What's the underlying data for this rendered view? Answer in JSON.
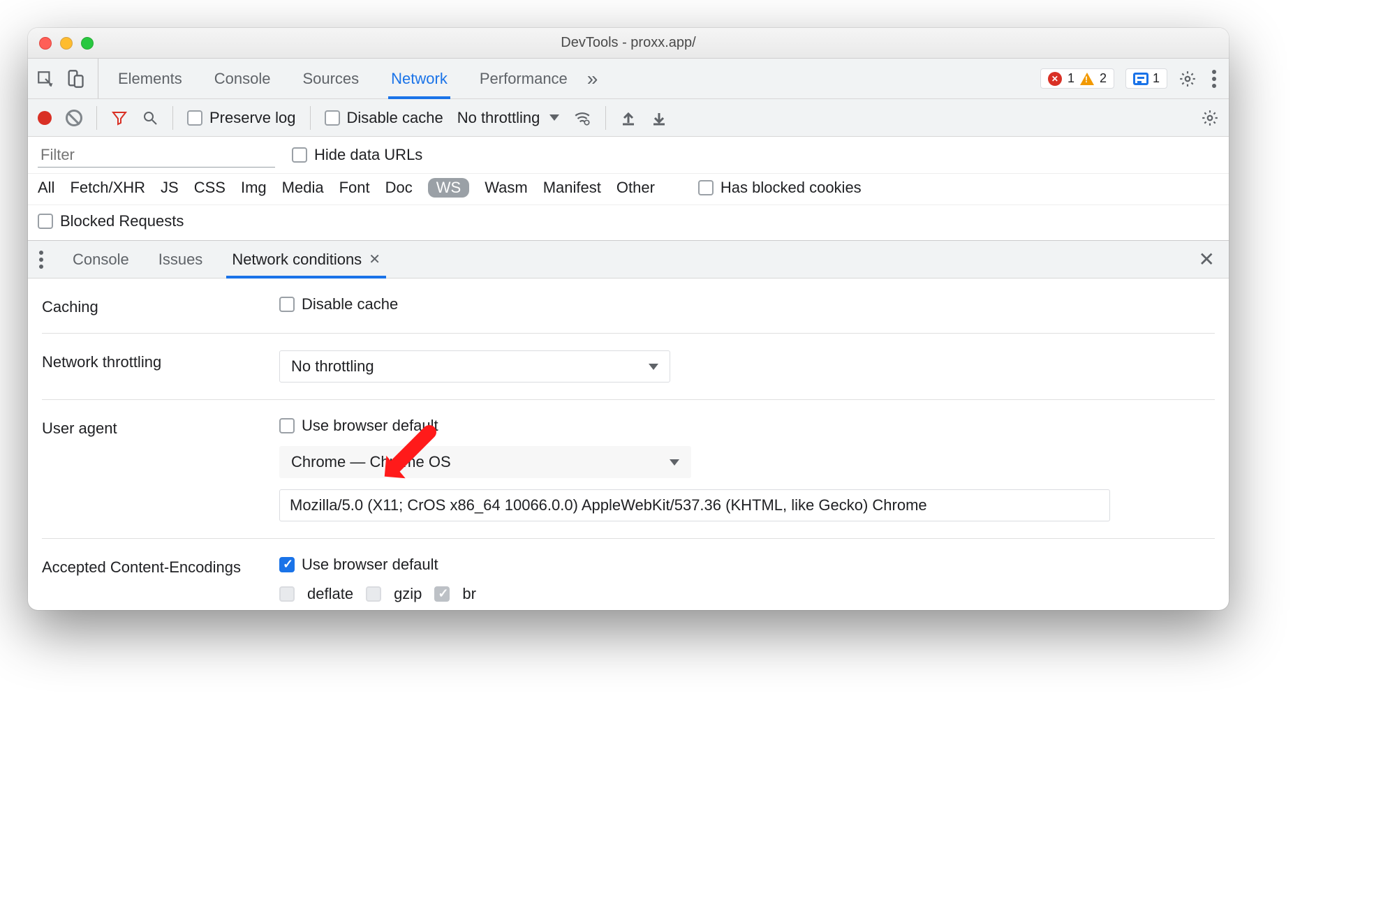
{
  "window": {
    "title": "DevTools - proxx.app/"
  },
  "tabbar": {
    "tabs": [
      "Elements",
      "Console",
      "Sources",
      "Network",
      "Performance"
    ],
    "active_index": 3,
    "overflow": "»",
    "errors_count": "1",
    "warnings_count": "2",
    "messages_count": "1"
  },
  "nettoolbar": {
    "preserve_log": "Preserve log",
    "disable_cache": "Disable cache",
    "throttling": "No throttling"
  },
  "filter": {
    "placeholder": "Filter",
    "hide_data_urls": "Hide data URLs"
  },
  "types": {
    "items": [
      "All",
      "Fetch/XHR",
      "JS",
      "CSS",
      "Img",
      "Media",
      "Font",
      "Doc",
      "WS",
      "Wasm",
      "Manifest",
      "Other"
    ],
    "selected_index": 8,
    "has_blocked_cookies": "Has blocked cookies"
  },
  "blocked": {
    "label": "Blocked Requests"
  },
  "drawer_tabs": {
    "items": [
      "Console",
      "Issues",
      "Network conditions"
    ],
    "active_index": 2
  },
  "conditions": {
    "caching_label": "Caching",
    "caching_disable": "Disable cache",
    "throttling_label": "Network throttling",
    "throttling_value": "No throttling",
    "ua_label": "User agent",
    "ua_browser_default": "Use browser default",
    "ua_select_value": "Chrome — Chrome OS",
    "ua_string": "Mozilla/5.0 (X11; CrOS x86_64 10066.0.0) AppleWebKit/537.36 (KHTML, like Gecko) Chrome",
    "enc_label": "Accepted Content-Encodings",
    "enc_browser_default": "Use browser default",
    "enc_deflate": "deflate",
    "enc_gzip": "gzip",
    "enc_br": "br"
  }
}
